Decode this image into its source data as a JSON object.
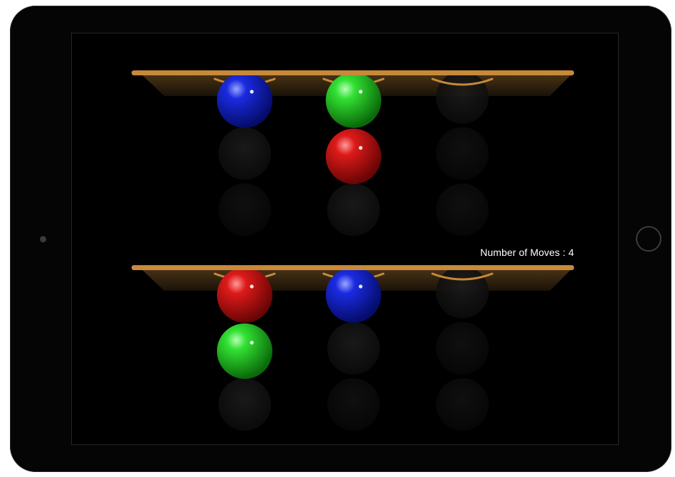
{
  "game": {
    "moves_label": "Number of Moves : 4",
    "colors": {
      "rack_wood": "#c8893a",
      "green": "#22cc22",
      "red": "#cc1111",
      "blue": "#1122dd"
    }
  },
  "racks": [
    {
      "name": "top-rack",
      "columns": [
        [
          "blue"
        ],
        [
          "green",
          "red"
        ],
        []
      ]
    },
    {
      "name": "bottom-rack",
      "columns": [
        [
          "red",
          "green"
        ],
        [
          "blue"
        ],
        []
      ]
    }
  ]
}
